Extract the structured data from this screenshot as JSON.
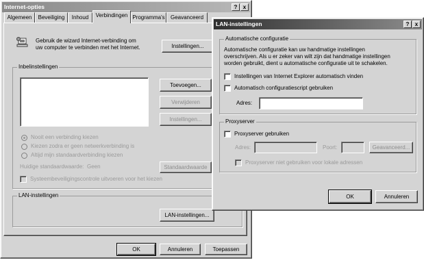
{
  "internet_options": {
    "title": "Internet-opties",
    "title_help": "?",
    "title_close": "x",
    "tabs": [
      "Algemeen",
      "Beveiliging",
      "Inhoud",
      "Verbindingen",
      "Programma's",
      "Geavanceerd"
    ],
    "wizard_text_line1": "Gebruik de wizard Internet-verbinding om",
    "wizard_text_line2": "uw computer te verbinden met het Internet.",
    "setup_button": "Instellingen...",
    "dialup_group_label": "Inbelinstellingen",
    "add_button": "Toevoegen...",
    "remove_button": "Verwijderen",
    "settings_button": "Instellingen...",
    "radio_never": "Nooit een verbinding kiezen",
    "radio_when_no_network": "Kiezen zodra er geen netwerkverbinding is",
    "radio_always": "Altijd mijn standaardverbinding kiezen",
    "current_default_label": "Huidige standaardwaarde:",
    "current_default_value": "Geen",
    "set_default_button": "Standaardwaarde",
    "security_check": "Systeembeveiligingscontrole uitvoeren voor het kiezen",
    "lan_group_label": "LAN-instellingen",
    "lan_button": "LAN-instellingen...",
    "ok_button": "OK",
    "cancel_button": "Annuleren",
    "apply_button": "Toepassen"
  },
  "lan_settings": {
    "title": "LAN-instellingen",
    "title_help": "?",
    "title_close": "x",
    "auto_group_label": "Automatische configuratie",
    "auto_desc_line1": "Automatische configuratie kan uw handmatige instellingen",
    "auto_desc_line2": "overschrijven. Als u er zeker van wilt zijn dat handmatige instellingen",
    "auto_desc_line3": "worden gebruikt, dient u automatische configuratie uit te schakelen.",
    "auto_detect_label": "Instellingen van Internet Explorer automatisch vinden",
    "auto_script_label": "Automatisch configuratiescript gebruiken",
    "address_label": "Adres:",
    "address_value": "",
    "proxy_group_label": "Proxyserver",
    "use_proxy_label": "Proxyserver gebruiken",
    "proxy_address_label": "Adres:",
    "proxy_port_label": "Poort:",
    "advanced_button": "Geavanceerd...",
    "bypass_local_label": "Proxyserver niet gebruiken voor lokale adressen",
    "ok_button": "OK",
    "cancel_button": "Annuleren"
  },
  "colors": {
    "dialog_face": "#d4d4d4",
    "active_titlebar": "#303030",
    "inactive_titlebar": "#8a8a8a",
    "disabled_text": "#9a9a9a"
  }
}
